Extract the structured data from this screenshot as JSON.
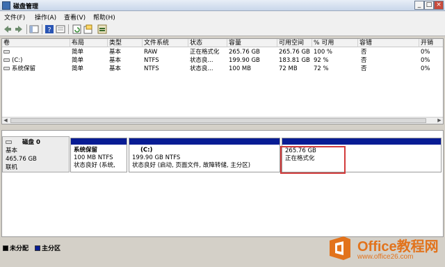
{
  "window": {
    "title": "磁盘管理"
  },
  "menu": [
    {
      "label": "文件(F)"
    },
    {
      "label": "操作(A)"
    },
    {
      "label": "查看(V)"
    },
    {
      "label": "帮助(H)"
    }
  ],
  "toolbar_icons": [
    "back-icon",
    "forward-icon",
    "console-tree-icon",
    "help-icon",
    "properties-icon",
    "refresh-icon",
    "export-icon",
    "wizard-icon"
  ],
  "volume_table": {
    "columns": [
      "卷",
      "布局",
      "类型",
      "文件系统",
      "状态",
      "容量",
      "可用空间",
      "% 可用",
      "容错",
      "开销"
    ],
    "rows": [
      {
        "volume": "",
        "layout": "简单",
        "type": "基本",
        "fs": "RAW",
        "status": "正在格式化",
        "capacity": "265.76 GB",
        "free": "265.76 GB",
        "pct": "100 %",
        "fault": "否",
        "overhead": "0%"
      },
      {
        "volume": "(C:)",
        "layout": "简单",
        "type": "基本",
        "fs": "NTFS",
        "status": "状态良...",
        "capacity": "199.90 GB",
        "free": "183.81 GB",
        "pct": "92 %",
        "fault": "否",
        "overhead": "0%"
      },
      {
        "volume": "系统保留",
        "layout": "简单",
        "type": "基本",
        "fs": "NTFS",
        "status": "状态良...",
        "capacity": "100 MB",
        "free": "72 MB",
        "pct": "72 %",
        "fault": "否",
        "overhead": "0%"
      }
    ]
  },
  "disk": {
    "name": "磁盘 0",
    "type": "基本",
    "size": "465.76 GB",
    "state": "联机",
    "partitions": [
      {
        "title": "系统保留",
        "line1": "100 MB NTFS",
        "line2": "状态良好 (系统,",
        "selected": false
      },
      {
        "title": "(C:)",
        "line1": "199.90 GB NTFS",
        "line2": "状态良好 (启动, 页面文件, 故障转储, 主分区)",
        "selected": false
      },
      {
        "title": "",
        "line1": "265.76 GB",
        "line2": "正在格式化",
        "selected": true
      }
    ]
  },
  "legend": [
    {
      "label": "未分配",
      "color": "#000000"
    },
    {
      "label": "主分区",
      "color": "#081c94"
    }
  ],
  "watermark": {
    "brand": "Office教程网",
    "url": "www.office26.com",
    "color": "#e2731c"
  }
}
